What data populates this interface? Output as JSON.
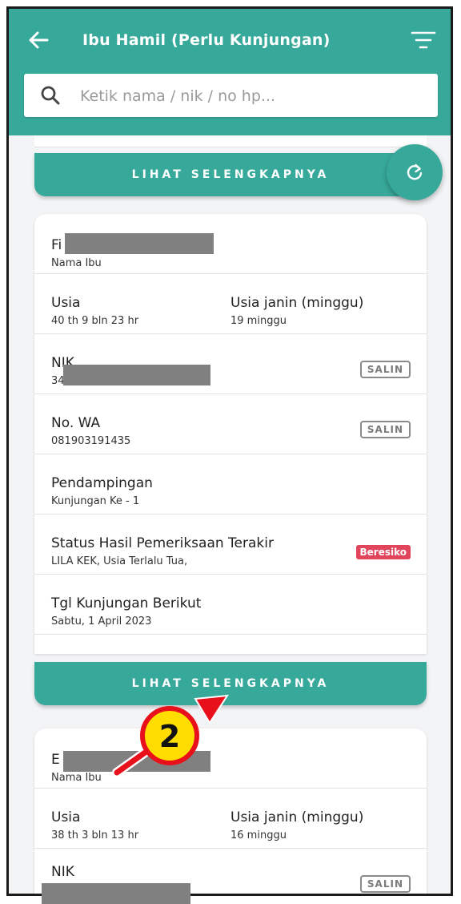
{
  "header": {
    "title": "Ibu Hamil (Perlu Kunjungan)",
    "search_placeholder": "Ketik nama / nik / no hp..."
  },
  "more_label": "LIHAT SELENGKAPNYA",
  "cards": [
    {
      "name_prefix": "Fi",
      "name_caption": "Nama Ibu",
      "usia_label": "Usia",
      "usia_value": "40 th 9 bln 23 hr",
      "janin_label": "Usia janin (minggu)",
      "janin_value": "19 minggu",
      "nik_label": "NIK",
      "nik_prefix": "34",
      "copy_label": "SALIN",
      "wa_label": "No. WA",
      "wa_value": "081903191435",
      "pendampingan_label": "Pendampingan",
      "pendampingan_value": "Kunjungan Ke - 1",
      "status_label": "Status Hasil Pemeriksaan Terakir",
      "status_value": "LILA KEK, Usia Terlalu Tua,",
      "status_badge": "Beresiko",
      "next_label": "Tgl Kunjungan Berikut",
      "next_value": "Sabtu, 1 April 2023"
    },
    {
      "name_prefix": "E",
      "name_caption": "Nama Ibu",
      "usia_label": "Usia",
      "usia_value": "38 th 3 bln 13 hr",
      "janin_label": "Usia janin (minggu)",
      "janin_value": "16 minggu",
      "nik_label": "NIK",
      "copy_label": "SALIN"
    }
  ],
  "callout": {
    "number": "2"
  },
  "colors": {
    "primary": "#37a99a",
    "danger": "#e0455c",
    "callout_fill": "#ffdd00",
    "callout_ring": "#e8101a"
  }
}
